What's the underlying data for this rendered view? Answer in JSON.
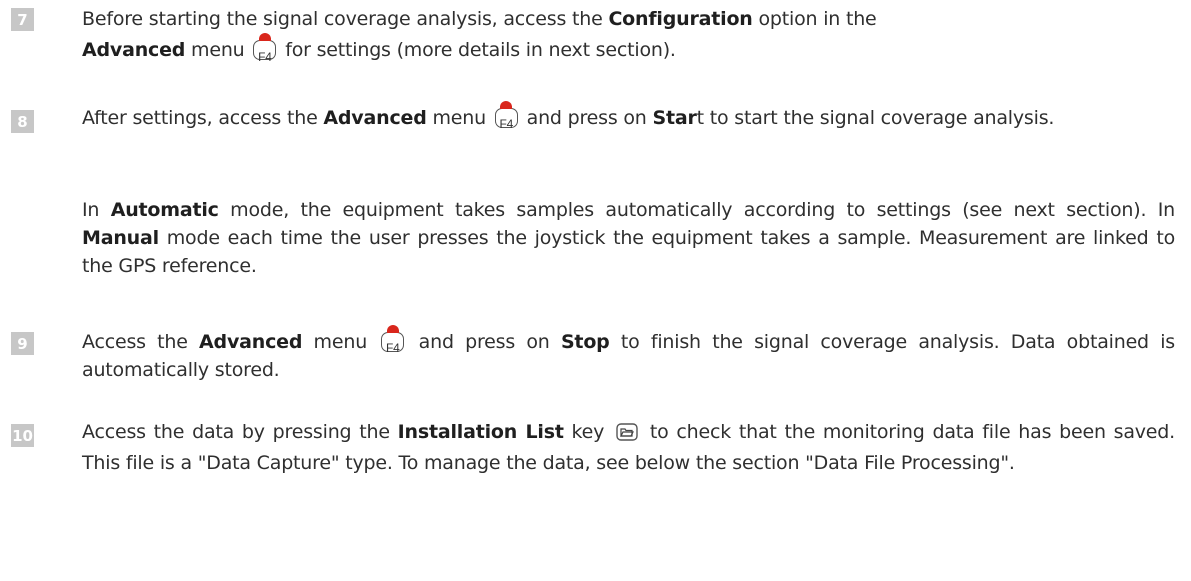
{
  "steps": [
    {
      "number": "7",
      "p1": {
        "t1": "Before starting the signal coverage analysis, access the ",
        "b1": "Configuration",
        "t2": " option in the ",
        "b2": "Advanced",
        "t3": " menu ",
        "key": "F4",
        "t4": " for settings (more details in next section)."
      }
    },
    {
      "number": "8",
      "p1": {
        "t1": "After settings, access the ",
        "b1": "Advanced",
        "t2": " menu ",
        "key": "F4",
        "t3": " and press on ",
        "b2": "Star",
        "t4": "t to start the signal coverage analysis."
      },
      "p2": {
        "t1": "In ",
        "b1": "Automatic",
        "t2": " mode, the equipment takes samples automatically according to settings (see next section). In ",
        "b2": "Manual",
        "t3": " mode each time the user presses the joystick the equipment takes a sample. Measurement are linked to the GPS reference."
      }
    },
    {
      "number": "9",
      "p1": {
        "t1": "Access the ",
        "b1": "Advanced",
        "t2": " menu ",
        "key": "F4",
        "t3": " and press on ",
        "b2": "Stop",
        "t4": " to finish the signal coverage analysis. Data obtained is automatically stored."
      }
    },
    {
      "number": "10",
      "p1": {
        "t1": "Access the data by pressing the ",
        "b1": "Installation List",
        "t2": " key ",
        "icon": "folder-icon",
        "t3": " to check that the monitoring data file has been saved. This file is a \"Data Capture\" type. To manage the data, see below the section \"Data File Processing\"."
      }
    }
  ]
}
